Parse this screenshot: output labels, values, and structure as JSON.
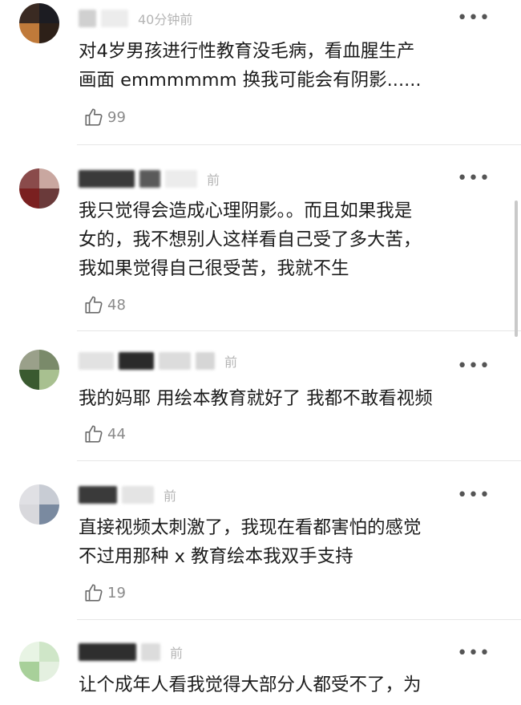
{
  "comments": [
    {
      "time": "40分钟前",
      "text_lines": [
        "对4岁男孩进行性教育没毛病，看血腥生产",
        "画面 emmmmmm 换我可能会有阴影......"
      ],
      "likes": "99",
      "avatar_colors": [
        "#3a2a22",
        "#1c1c22",
        "#c07a3a",
        "#2d2018"
      ]
    },
    {
      "time": "前",
      "text_lines": [
        "我只觉得会造成心理阴影。。而且如果我是",
        "女的，我不想别人这样看自己受了多大苦，",
        "我如果觉得自己很受苦，我就不生"
      ],
      "likes": "48",
      "avatar_colors": [
        "#8a4b4b",
        "#c9a7a0",
        "#7a2020",
        "#6a3a3a"
      ]
    },
    {
      "time": "前",
      "text_lines": [
        "我的妈耶 用绘本教育就好了 我都不敢看视频"
      ],
      "likes": "44",
      "avatar_colors": [
        "#9aa08a",
        "#7a8a6a",
        "#3a5a30",
        "#a8c090"
      ]
    },
    {
      "time": "前",
      "text_lines": [
        "直接视频太刺激了，我现在看都害怕的感觉",
        "不过用那种 x 教育绘本我双手支持"
      ],
      "likes": "19",
      "avatar_colors": [
        "#e0e0e4",
        "#c8ccd4",
        "#d8d8dc",
        "#7a8aa0"
      ]
    },
    {
      "time": "前",
      "text_lines": [
        "让个成年人看我觉得大部分人都受不了，为"
      ],
      "likes": "",
      "avatar_colors": [
        "#e8f4e4",
        "#cfe6c8",
        "#a8d09a",
        "#e4f0e0"
      ]
    }
  ],
  "more_icon": "more-dots-icon",
  "like_icon": "thumbs-up-icon"
}
